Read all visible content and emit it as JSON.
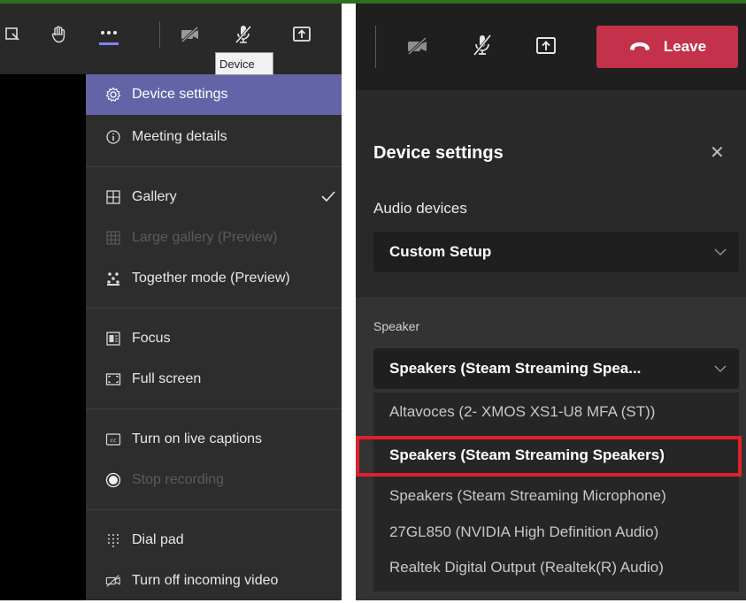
{
  "left_panel": {
    "toolbar": {
      "icons": [
        "share-tray-icon",
        "raise-hand-icon",
        "more-actions-icon",
        "camera-off-icon",
        "mic-off-icon",
        "share-icon"
      ]
    },
    "tooltip": "Device",
    "menu": {
      "groups": [
        [
          {
            "label": "Device settings",
            "icon": "gear-icon",
            "state": "active"
          },
          {
            "label": "Meeting details",
            "icon": "info-icon",
            "state": "normal"
          }
        ],
        [
          {
            "label": "Gallery",
            "icon": "gallery-icon",
            "state": "checked"
          },
          {
            "label": "Large gallery (Preview)",
            "icon": "large-gallery-icon",
            "state": "disabled"
          },
          {
            "label": "Together mode (Preview)",
            "icon": "together-mode-icon",
            "state": "normal"
          }
        ],
        [
          {
            "label": "Focus",
            "icon": "focus-icon",
            "state": "normal"
          },
          {
            "label": "Full screen",
            "icon": "full-screen-icon",
            "state": "normal"
          }
        ],
        [
          {
            "label": "Turn on live captions",
            "icon": "captions-icon",
            "state": "normal"
          },
          {
            "label": "Stop recording",
            "icon": "record-icon",
            "state": "disabled"
          }
        ],
        [
          {
            "label": "Dial pad",
            "icon": "dial-pad-icon",
            "state": "normal"
          },
          {
            "label": "Turn off incoming video",
            "icon": "video-off-icon",
            "state": "normal"
          }
        ]
      ]
    }
  },
  "right_panel": {
    "leave_label": "Leave",
    "title": "Device settings",
    "close_symbol": "✕",
    "audio_devices_label": "Audio devices",
    "audio_devices_value": "Custom Setup",
    "speaker_label": "Speaker",
    "speaker_value": "Speakers (Steam Streaming Spea...",
    "speaker_options": [
      {
        "label": "Altavoces (2- XMOS XS1-U8 MFA (ST))",
        "selected": false
      },
      {
        "label": "Speakers (Steam Streaming Speakers)",
        "selected": true
      },
      {
        "label": "Speakers (Steam Streaming Microphone)",
        "selected": false
      },
      {
        "label": "27GL850 (NVIDIA High Definition Audio)",
        "selected": false
      },
      {
        "label": "Realtek Digital Output (Realtek(R) Audio)",
        "selected": false
      }
    ]
  },
  "colors": {
    "accent": "#6264a7",
    "leave": "#c4314b",
    "highlight": "#e0202b"
  }
}
